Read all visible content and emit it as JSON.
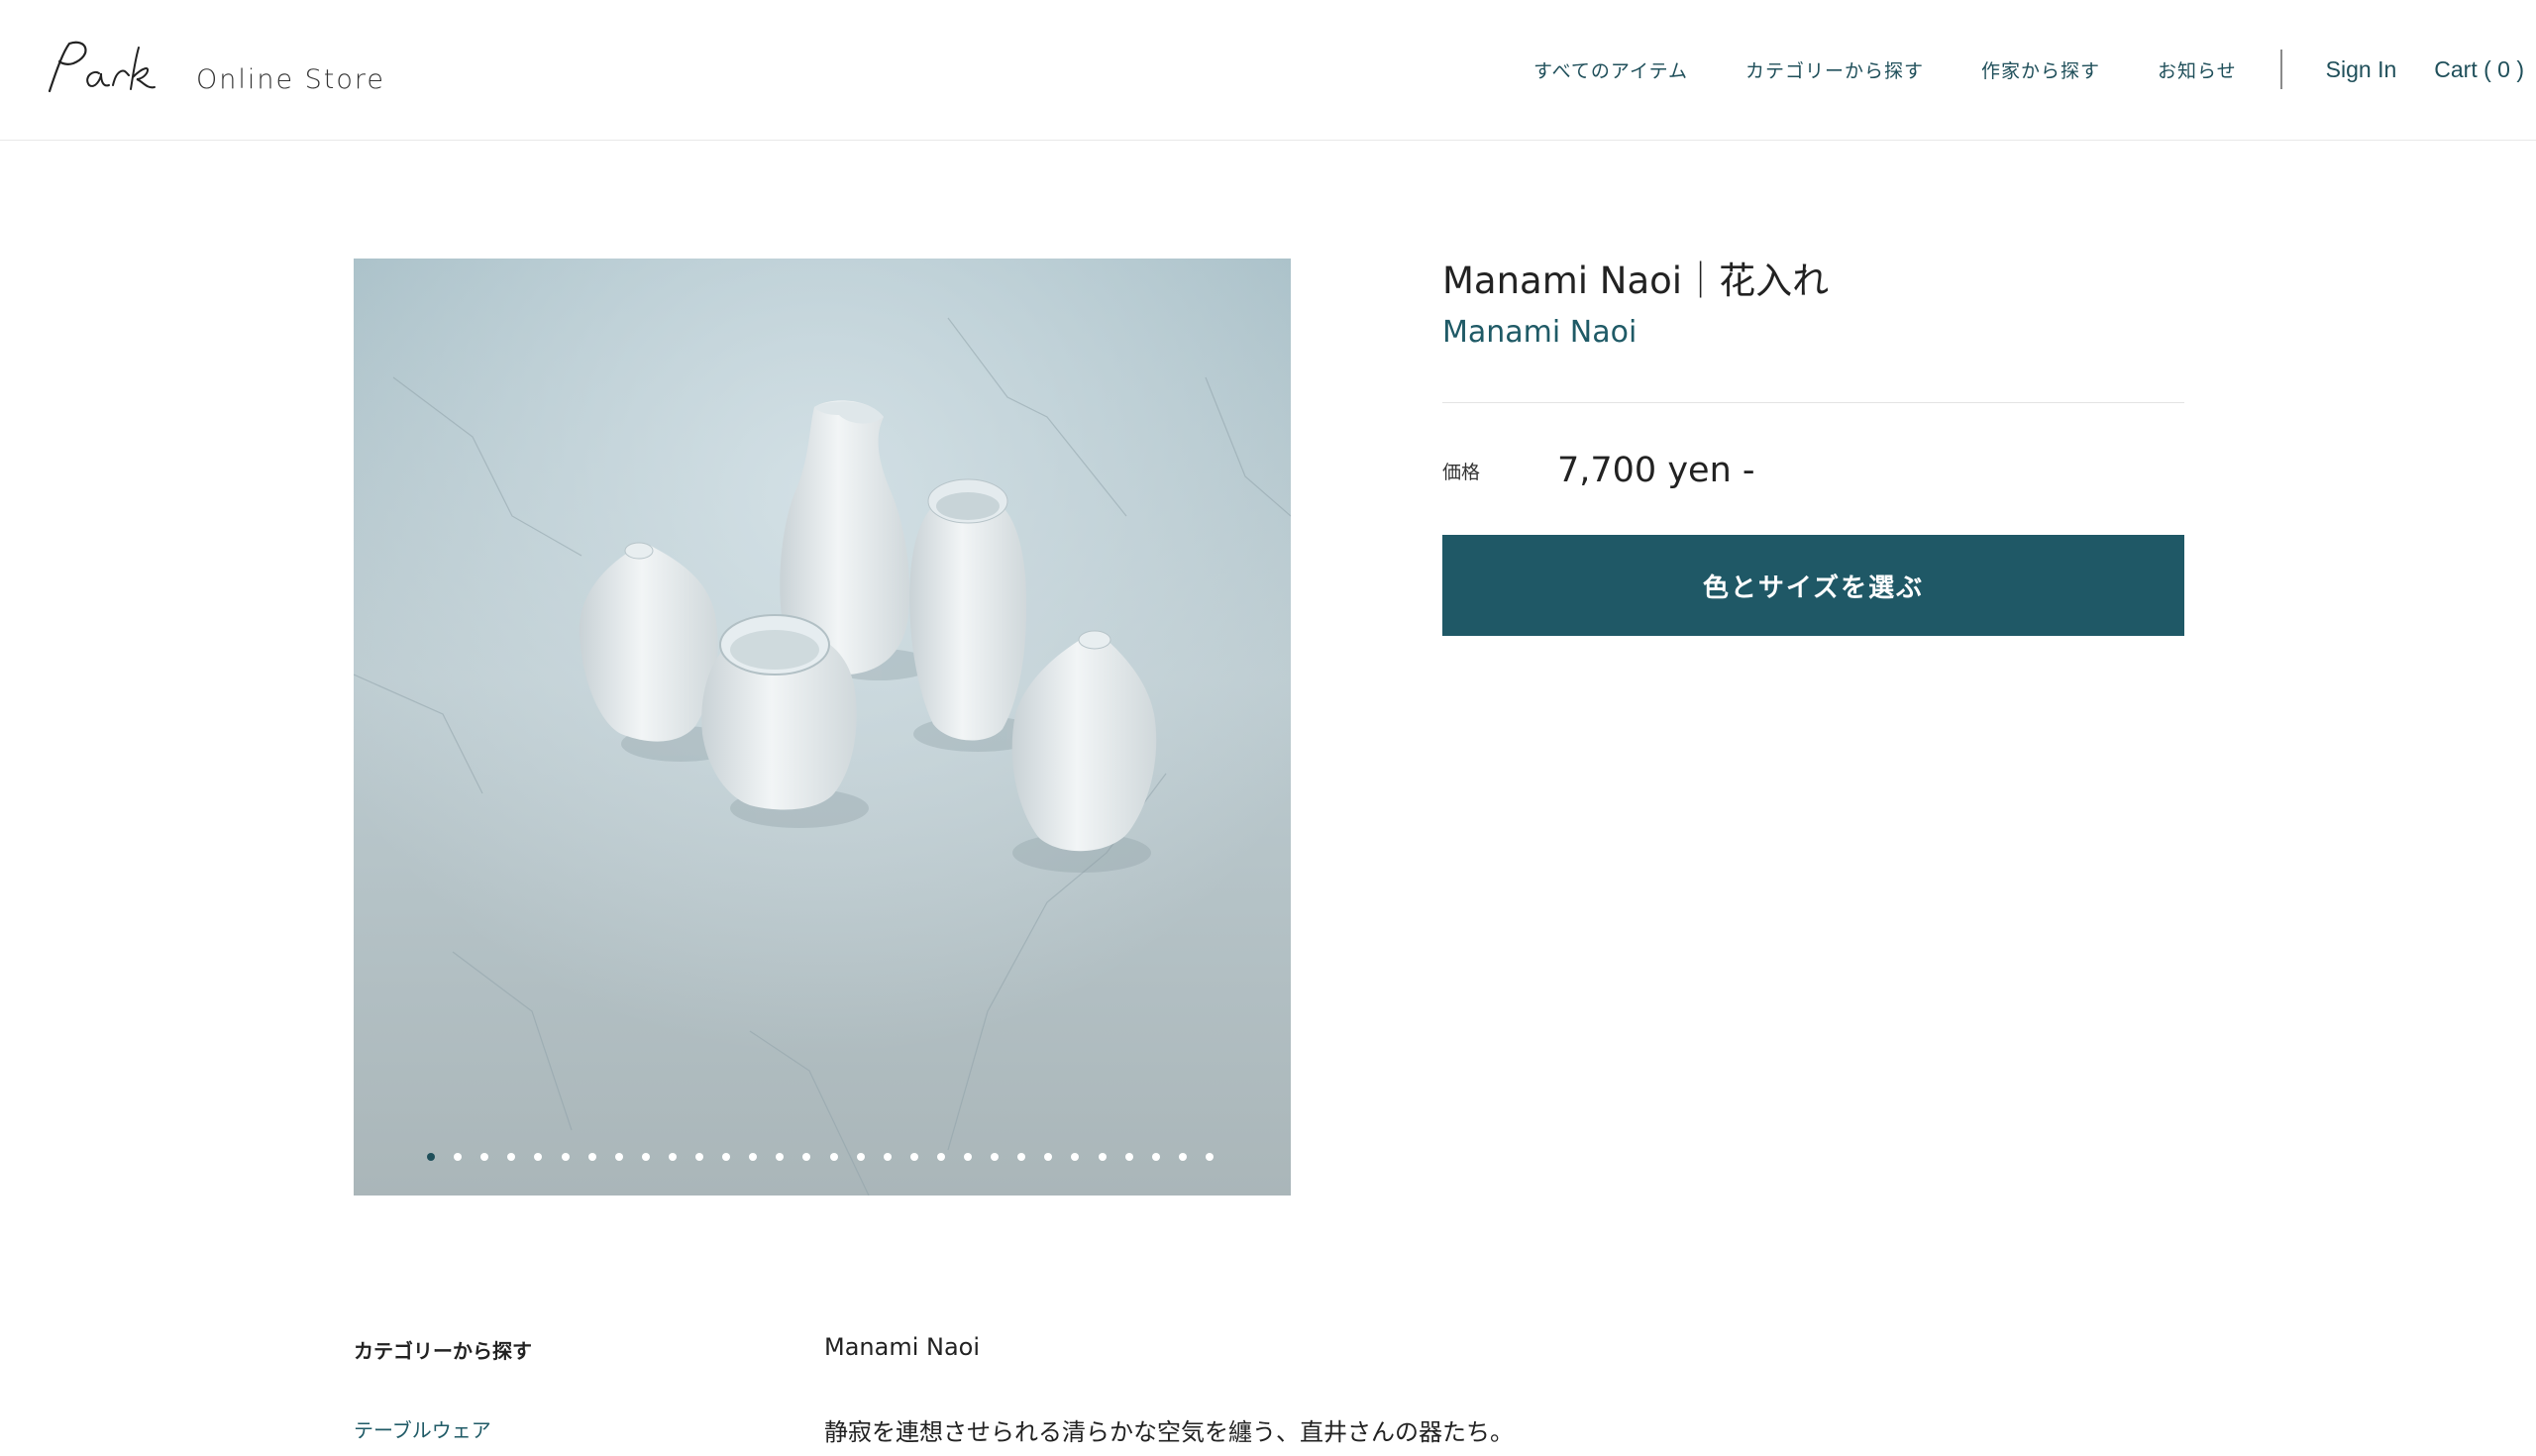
{
  "header": {
    "logo_alt": "Park",
    "logo_subtitle": "Online Store",
    "nav": [
      {
        "label": "すべてのアイテム"
      },
      {
        "label": "カテゴリーから探す"
      },
      {
        "label": "作家から探す"
      },
      {
        "label": "お知らせ"
      }
    ],
    "sign_in": "Sign In",
    "cart": "Cart ( 0 )"
  },
  "gallery": {
    "image_count": 30,
    "active_index": 0
  },
  "product": {
    "title": "Manami Naoi｜花入れ",
    "artist": "Manami Naoi",
    "price_label": "価格",
    "price": "7,700 yen -",
    "select_button": "色とサイズを選ぶ"
  },
  "details": {
    "category_heading": "カテゴリーから探す",
    "category_link": "テーブルウェア",
    "artist_name": "Manami Naoi",
    "description": "静寂を連想させられる清らかな空気を纏う、直井さんの器たち。"
  },
  "colors": {
    "accent": "#1f5866",
    "link": "#1f4f5a"
  }
}
